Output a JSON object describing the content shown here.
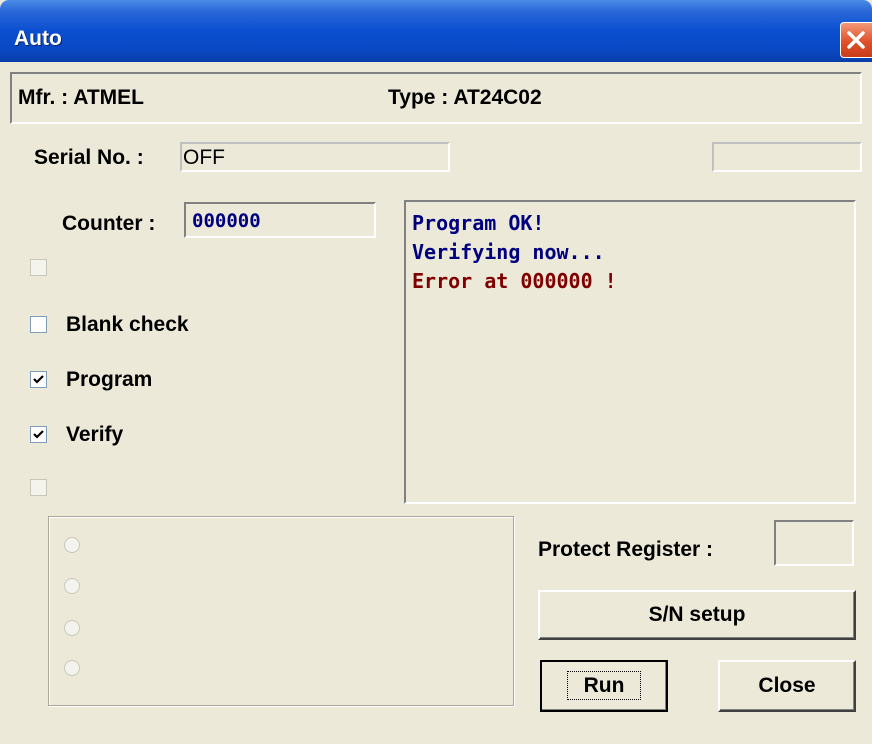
{
  "window": {
    "title": "Auto"
  },
  "info_bar": {
    "mfr": "Mfr. : ATMEL",
    "type": "Type : AT24C02"
  },
  "serial": {
    "label": "Serial No. :",
    "value": "OFF",
    "extra_value": ""
  },
  "counter": {
    "label": "Counter :",
    "value": "000000"
  },
  "options": [
    {
      "label": "",
      "checked": false,
      "enabled": false
    },
    {
      "label": "Blank check",
      "checked": false,
      "enabled": true
    },
    {
      "label": "Program",
      "checked": true,
      "enabled": true
    },
    {
      "label": "Verify",
      "checked": true,
      "enabled": true
    },
    {
      "label": "",
      "checked": false,
      "enabled": false
    }
  ],
  "log": [
    {
      "text": "Program OK!",
      "color": "#00007f"
    },
    {
      "text": "Verifying now...",
      "color": "#00007f"
    },
    {
      "text": "Error at 000000 !",
      "color": "#7f0000"
    }
  ],
  "radio_group": {
    "options": [
      "",
      "",
      "",
      ""
    ]
  },
  "protect_register": {
    "label": "Protect Register :",
    "value": ""
  },
  "buttons": {
    "sn_setup": "S/N setup",
    "run": "Run",
    "close": "Close"
  },
  "colors": {
    "face": "#ece9d8",
    "title_blue": "#0a4fd0",
    "counter_text": "#000080",
    "error_text": "#7f0000"
  }
}
